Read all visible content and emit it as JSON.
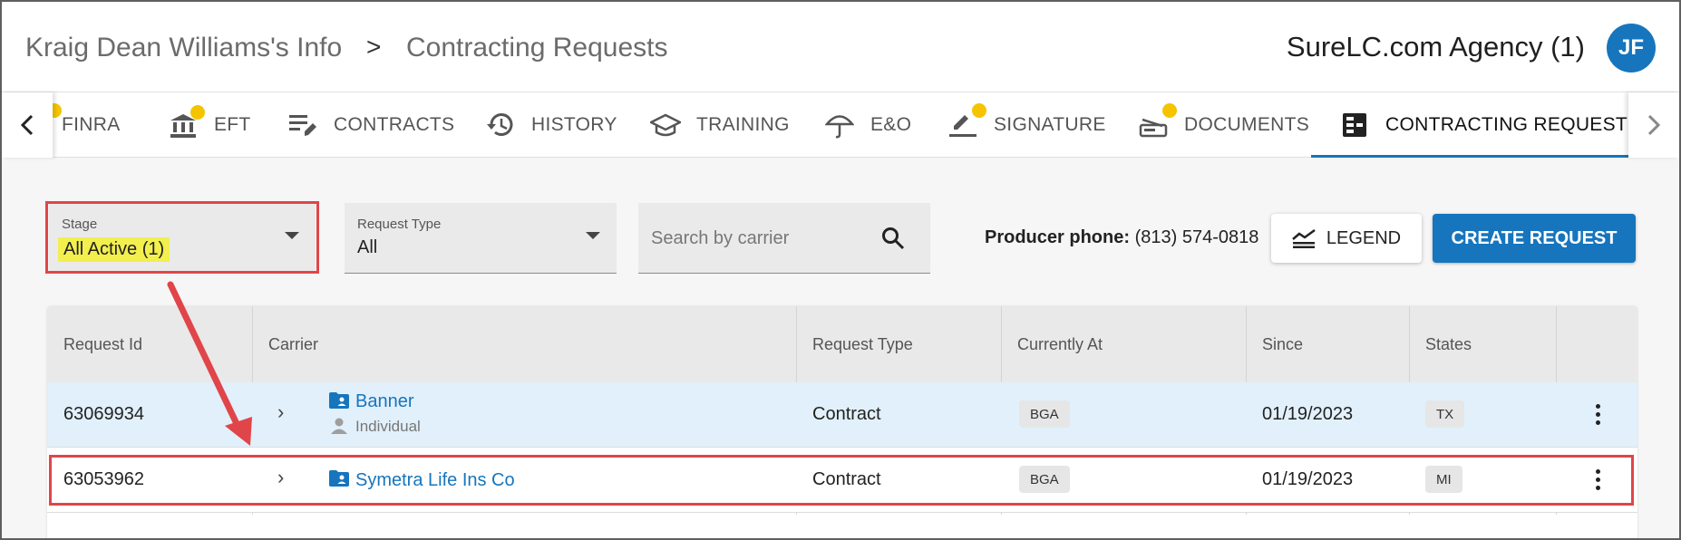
{
  "breadcrumb": {
    "parent": "Kraig Dean Williams's Info",
    "separator": ">",
    "current": "Contracting Requests"
  },
  "agency": {
    "name": "SureLC.com Agency (1)",
    "avatar_initials": "JF"
  },
  "tabs": [
    {
      "label": "FINRA",
      "icon": "badge-icon",
      "dot": true
    },
    {
      "label": "EFT",
      "icon": "bank-icon",
      "dot": true
    },
    {
      "label": "CONTRACTS",
      "icon": "edit-list-icon",
      "dot": false
    },
    {
      "label": "HISTORY",
      "icon": "history-icon",
      "dot": false
    },
    {
      "label": "TRAINING",
      "icon": "school-icon",
      "dot": false
    },
    {
      "label": "E&O",
      "icon": "umbrella-icon",
      "dot": false
    },
    {
      "label": "SIGNATURE",
      "icon": "pen-icon",
      "dot": true
    },
    {
      "label": "DOCUMENTS",
      "icon": "scanner-icon",
      "dot": true
    },
    {
      "label": "CONTRACTING REQUESTS",
      "icon": "dashboard-icon",
      "dot": false,
      "active": true
    }
  ],
  "filters": {
    "stage": {
      "label": "Stage",
      "value": "All Active (1)"
    },
    "request_type": {
      "label": "Request Type",
      "value": "All"
    },
    "search": {
      "placeholder": "Search by carrier"
    }
  },
  "producer_phone": {
    "label": "Producer phone:",
    "value": "(813) 574-0818"
  },
  "buttons": {
    "legend": "LEGEND",
    "create": "CREATE REQUEST"
  },
  "table": {
    "headers": [
      "Request Id",
      "Carrier",
      "Request Type",
      "Currently At",
      "Since",
      "States"
    ],
    "rows": [
      {
        "id": "63069934",
        "carrier": "Banner",
        "carrier_sub": "Individual",
        "type": "Contract",
        "at": "BGA",
        "since": "01/19/2023",
        "state": "TX"
      },
      {
        "id": "63053962",
        "carrier": "Symetra Life Ins Co",
        "carrier_sub": "",
        "type": "Contract",
        "at": "BGA",
        "since": "01/19/2023",
        "state": "MI"
      }
    ]
  },
  "colors": {
    "primary": "#1675bd",
    "highlight": "#f2ef4f",
    "annotation": "#e0454a",
    "dot": "#f5c400"
  }
}
